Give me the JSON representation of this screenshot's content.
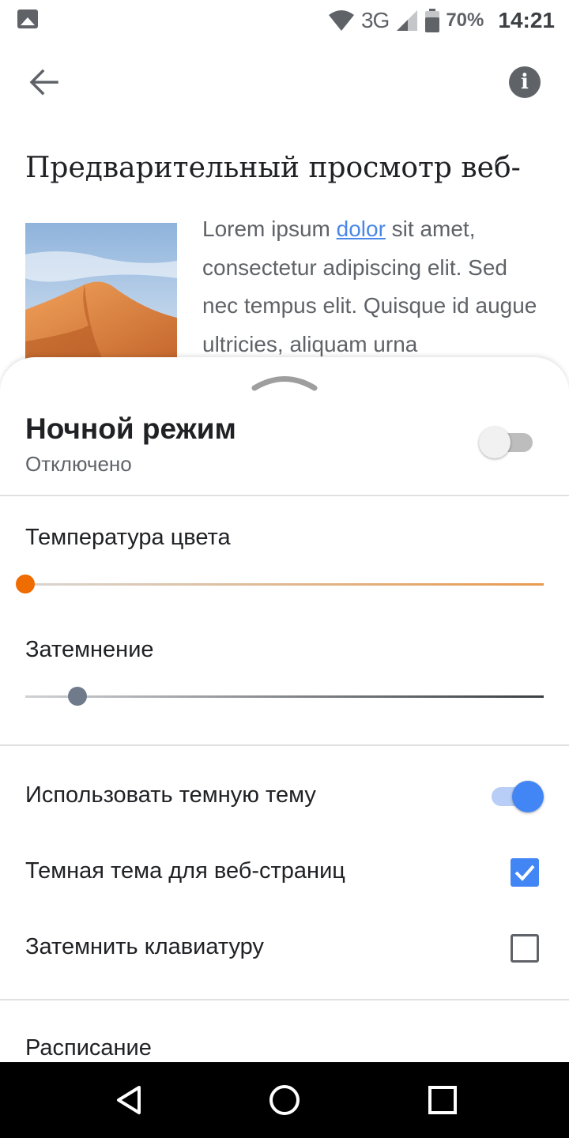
{
  "status_bar": {
    "network": "3G",
    "battery": "70%",
    "time": "14:21",
    "icons": [
      "image-notification-icon",
      "wifi-icon",
      "signal-icon",
      "battery-icon"
    ]
  },
  "toolbar": {
    "back_icon": "arrow-back-icon",
    "info_icon": "info-icon",
    "info_glyph": "i"
  },
  "preview": {
    "title": "Предварительный просмотр веб-",
    "text_before_link": "Lorem ipsum ",
    "link": "dolor",
    "text_after_link": " sit amet, consectetur adipiscing elit. Sed nec tempus elit. Quisque id augue ultricies, aliquam urna"
  },
  "sheet": {
    "night_mode": {
      "title": "Ночной режим",
      "status": "Отключено",
      "enabled": false
    },
    "color_temperature": {
      "label": "Температура цвета",
      "value": 0.0
    },
    "dimming": {
      "label": "Затемнение",
      "value": 0.1
    },
    "dark_theme": {
      "label": "Использовать темную тему",
      "enabled": true
    },
    "dark_web": {
      "label": "Темная тема для веб-страниц",
      "checked": true
    },
    "dim_keyboard": {
      "label": "Затемнить клавиатуру",
      "checked": false
    },
    "schedule": {
      "label": "Расписание"
    }
  },
  "colors": {
    "accent": "#4285f4",
    "temperature_knob": "#ef6c00",
    "link": "#4a86e8"
  },
  "nav": {
    "icons": [
      "nav-back-icon",
      "nav-home-icon",
      "nav-recents-icon"
    ]
  }
}
